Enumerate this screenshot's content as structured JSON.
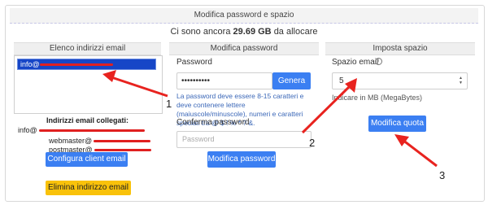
{
  "panel": {
    "title": "Modifica password e spazio",
    "summary_prefix": "Ci sono ancora",
    "summary_value": "29.69 GB",
    "summary_suffix": "da allocare"
  },
  "emails": {
    "header": "Elenco indirizzi email",
    "selected_item": "info@",
    "linked_title": "Indirizzi email collegati:",
    "linked": [
      "info@",
      "webmaster@",
      "postmaster@"
    ],
    "configure_button": "Configura client email",
    "delete_button": "Elimina indirizzo email"
  },
  "password": {
    "header": "Modifica password",
    "label": "Password",
    "value": "••••••••••",
    "generate_button": "Genera",
    "help": "La password deve essere 8-15 caratteri e deve contenere lettere (maiuscole/minuscole), numeri e caratteri speciali tra @ $ ! % * ? &.",
    "confirm_label": "Conferma password",
    "confirm_placeholder": "Password",
    "submit_button": "Modifica password"
  },
  "space": {
    "header": "Imposta spazio",
    "label": "Spazio email",
    "info_icon": "info-circle-icon",
    "value": "5",
    "help": "Indicare in MB (MegaBytes)",
    "submit_button": "Modifica quota"
  },
  "annotations": {
    "callout_1": "1",
    "callout_2": "2",
    "callout_3": "3",
    "arrow_color": "#e8231f"
  }
}
